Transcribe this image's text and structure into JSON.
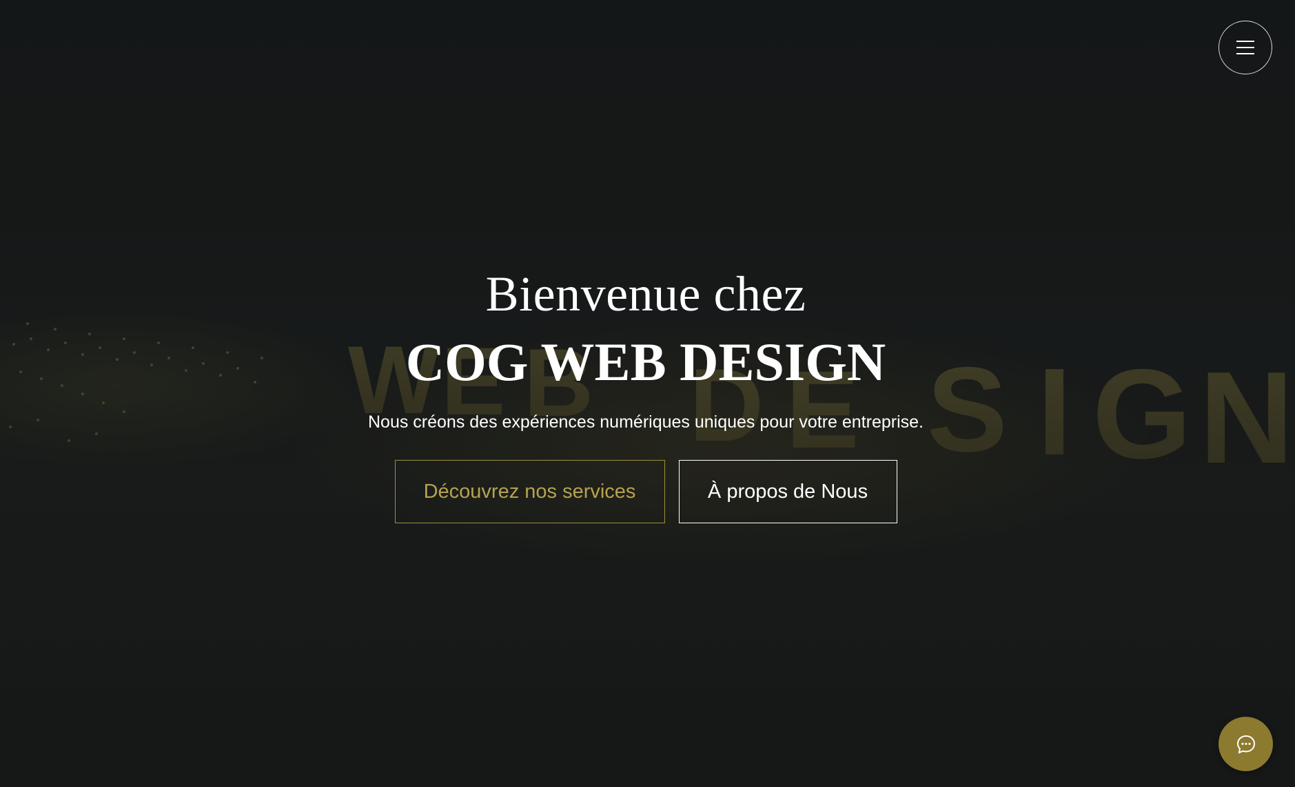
{
  "header": {
    "menu_icon": "hamburger-menu-icon"
  },
  "hero": {
    "background_letters": [
      "W",
      "E",
      "B",
      "D",
      "E",
      "S",
      "I",
      "G",
      "N"
    ],
    "eyebrow": "Bienvenue chez",
    "title": "COG WEB DESIGN",
    "subtitle": "Nous créons des expériences numériques uniques pour votre entreprise.",
    "buttons": {
      "services_label": "Découvrez nos services",
      "about_label": "À propos de Nous"
    }
  },
  "chat": {
    "icon": "chat-bubble-icon"
  },
  "colors": {
    "background": "#161819",
    "accent_gold": "#8c7a2f",
    "accent_gold_text": "#b7a34f",
    "text": "#ffffff"
  }
}
